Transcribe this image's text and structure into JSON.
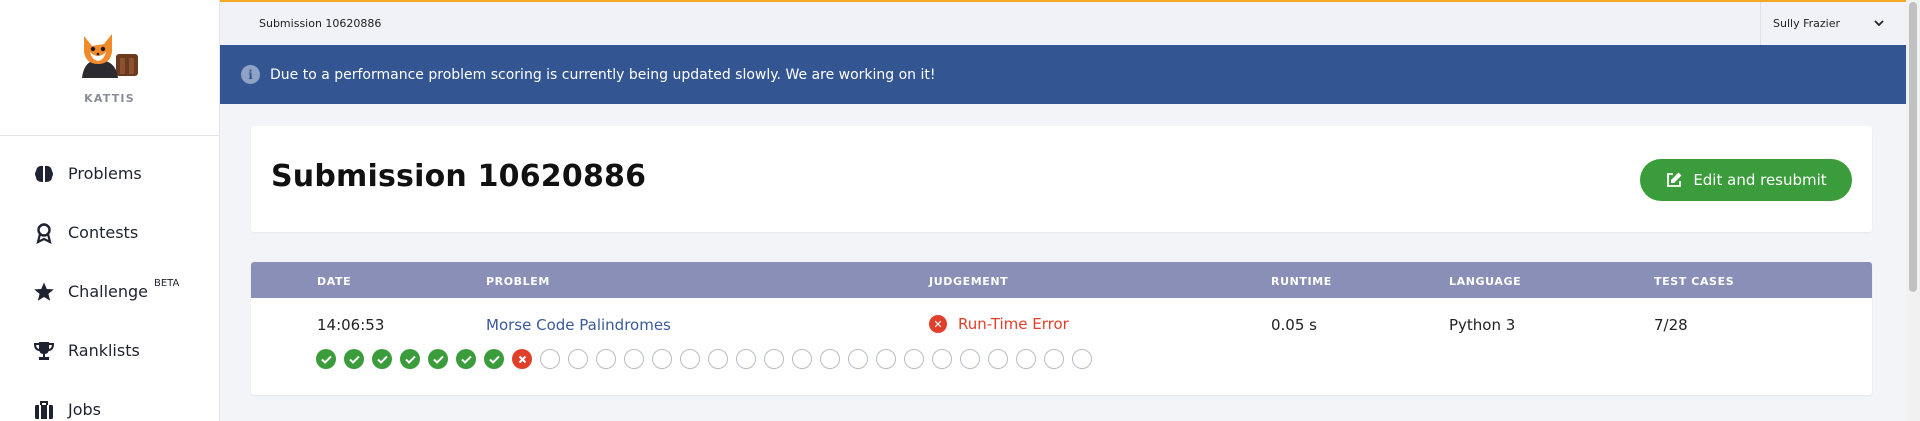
{
  "brand": {
    "name": "KATTIS"
  },
  "sidebar": {
    "items": [
      {
        "label": "Problems",
        "icon": "brain-icon"
      },
      {
        "label": "Contests",
        "icon": "ribbon-icon"
      },
      {
        "label": "Challenge",
        "icon": "star-icon",
        "badge": "BETA"
      },
      {
        "label": "Ranklists",
        "icon": "trophy-icon"
      },
      {
        "label": "Jobs",
        "icon": "briefcase-icon"
      }
    ]
  },
  "topbar": {
    "breadcrumb": "Submission 10620886",
    "user": "Sully Frazier"
  },
  "banner": {
    "icon": "info-icon",
    "text": "Due to a performance problem scoring is currently being updated slowly. We are working on it!"
  },
  "page": {
    "title": "Submission 10620886",
    "resubmit_label": "Edit and resubmit"
  },
  "table": {
    "headers": {
      "date": "DATE",
      "problem": "PROBLEM",
      "judgement": "JUDGEMENT",
      "runtime": "RUNTIME",
      "language": "LANGUAGE",
      "test_cases": "TEST CASES"
    },
    "row": {
      "date": "14:06:53",
      "problem": "Morse Code Palindromes",
      "judgement": "Run-Time Error",
      "runtime": "0.05 s",
      "language": "Python 3",
      "test_cases": "7/28"
    },
    "case_results": [
      "pass",
      "pass",
      "pass",
      "pass",
      "pass",
      "pass",
      "pass",
      "fail",
      "none",
      "none",
      "none",
      "none",
      "none",
      "none",
      "none",
      "none",
      "none",
      "none",
      "none",
      "none",
      "none",
      "none",
      "none",
      "none",
      "none",
      "none",
      "none",
      "none"
    ]
  },
  "colors": {
    "accent_green": "#3a9c3a",
    "error_red": "#e0402a",
    "banner_blue": "#335591",
    "table_header": "#8a8fb8",
    "top_border": "#f5a623"
  }
}
